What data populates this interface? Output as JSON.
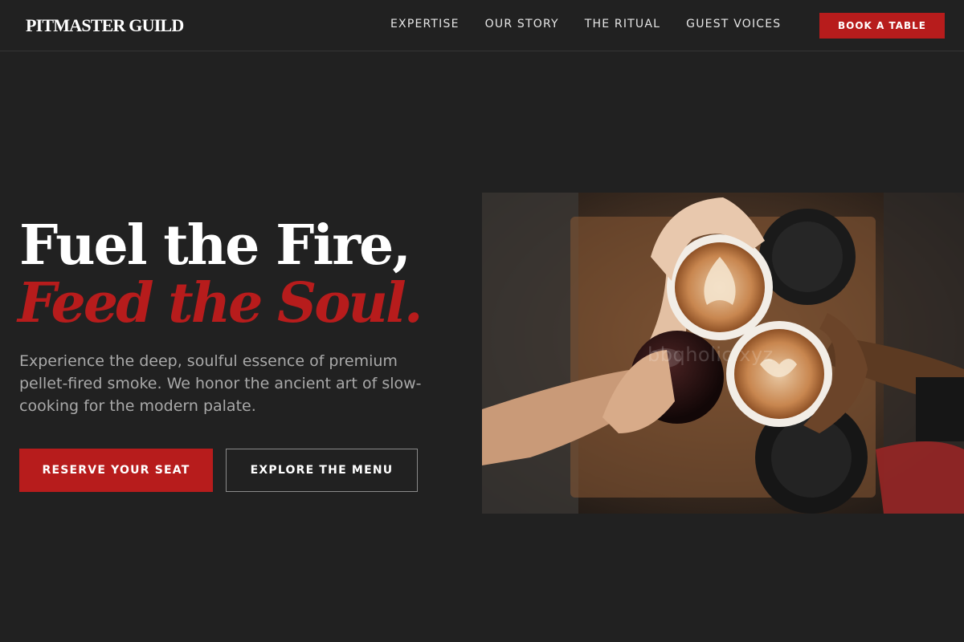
{
  "header": {
    "logo": "PITMASTER GUILD",
    "nav": [
      "EXPERTISE",
      "OUR STORY",
      "THE RITUAL",
      "GUEST VOICES"
    ],
    "cta": "BOOK A TABLE"
  },
  "hero": {
    "headline_line1": "Fuel the Fire,",
    "headline_line2": "Feed the Soul.",
    "description": "Experience the deep, soulful essence of premium pellet-fired smoke. We honor the ancient art of slow-cooking for the modern palate.",
    "primary_button": "RESERVE YOUR SEAT",
    "secondary_button": "EXPLORE THE MENU",
    "image_watermark": "bbqholic.xyz"
  },
  "colors": {
    "background": "#212121",
    "accent": "#b71c1c",
    "text": "#ffffff",
    "muted_text": "#a9a9a9"
  }
}
